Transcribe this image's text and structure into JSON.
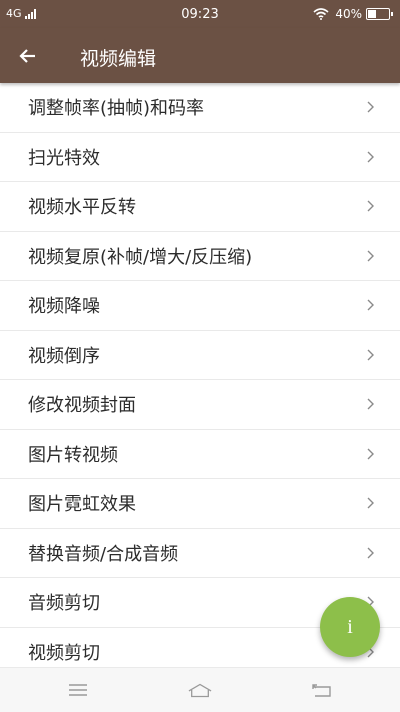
{
  "status_bar": {
    "network": "4G",
    "time": "09:23",
    "battery": "40%",
    "icons": [
      "signal-icon",
      "wifi-icon",
      "battery-icon"
    ]
  },
  "app_bar": {
    "title": "视频编辑",
    "back_icon": "arrow-left-icon"
  },
  "menu": {
    "items": [
      {
        "label": "调整帧率(抽帧)和码率"
      },
      {
        "label": "扫光特效"
      },
      {
        "label": "视频水平反转"
      },
      {
        "label": "视频复原(补帧/增大/反压缩)"
      },
      {
        "label": "视频降噪"
      },
      {
        "label": "视频倒序"
      },
      {
        "label": "修改视频封面"
      },
      {
        "label": "图片转视频"
      },
      {
        "label": "图片霓虹效果"
      },
      {
        "label": "替换音频/合成音频"
      },
      {
        "label": "音频剪切"
      },
      {
        "label": "视频剪切"
      }
    ]
  },
  "fab": {
    "label": "i",
    "color": "#8dbf4a"
  },
  "colors": {
    "app_bar": "#6b5144",
    "text": "#2c2c2c",
    "divider": "#e9e9e9"
  }
}
